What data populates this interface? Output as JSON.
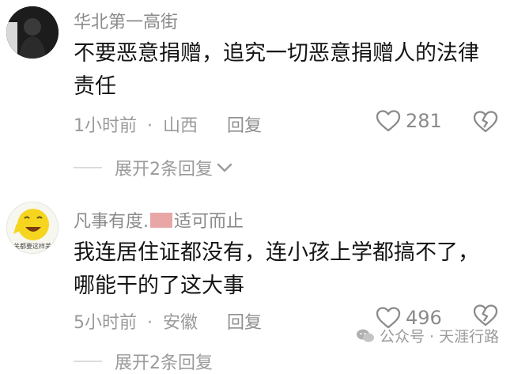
{
  "comments": [
    {
      "username": "华北第一高街",
      "text_line1": "不要恶意捐赠，追究一切恶意捐赠人的法律",
      "text_line2": "责任",
      "time": "1小时前",
      "location": "山西",
      "reply_label": "回复",
      "likes": "281",
      "expand_label": "展开2条回复"
    },
    {
      "username_part1": "凡事有度.",
      "username_part2": "适可而止",
      "avatar_caption": "关都要这样美",
      "text_line1": "我连居住证都没有，连小孩上学都搞不了，",
      "text_line2": "哪能干的了这大事",
      "time": "5小时前",
      "location": "安徽",
      "reply_label": "回复",
      "likes": "496",
      "expand_label": "展开2条回复"
    }
  ],
  "separator": "·",
  "watermark": "公众号 · 天涯行路"
}
